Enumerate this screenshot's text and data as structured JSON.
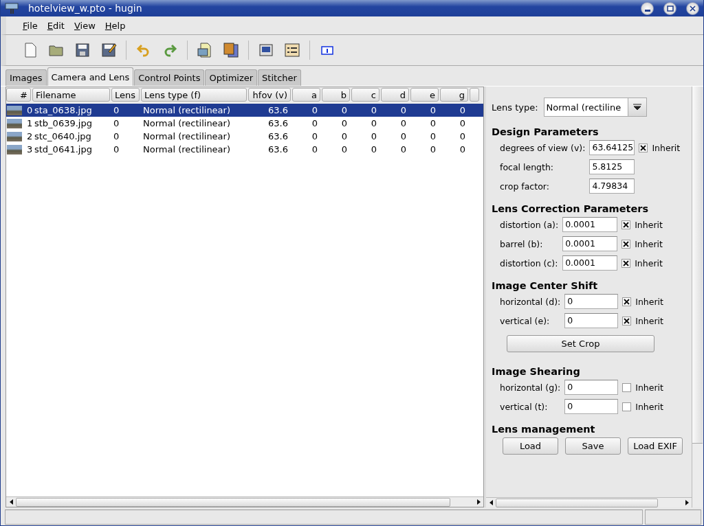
{
  "window": {
    "title": "hotelview_w.pto - hugin"
  },
  "menu": [
    "File",
    "Edit",
    "View",
    "Help"
  ],
  "tabs": [
    {
      "label": "Images",
      "selected": false
    },
    {
      "label": "Camera and Lens",
      "selected": true
    },
    {
      "label": "Control Points",
      "selected": false
    },
    {
      "label": "Optimizer",
      "selected": false
    },
    {
      "label": "Stitcher",
      "selected": false
    }
  ],
  "table": {
    "columns": [
      "#",
      "Filename",
      "Lens",
      "Lens type (f)",
      "hfov (v)",
      "a",
      "b",
      "c",
      "d",
      "e",
      "g"
    ],
    "rows": [
      {
        "cells": [
          "0",
          "sta_0638.jpg",
          "0",
          "Normal (rectilinear)",
          "63.6",
          "0",
          "0",
          "0",
          "0",
          "0",
          "0"
        ],
        "selected": true
      },
      {
        "cells": [
          "1",
          "stb_0639.jpg",
          "0",
          "Normal (rectilinear)",
          "63.6",
          "0",
          "0",
          "0",
          "0",
          "0",
          "0"
        ],
        "selected": false
      },
      {
        "cells": [
          "2",
          "stc_0640.jpg",
          "0",
          "Normal (rectilinear)",
          "63.6",
          "0",
          "0",
          "0",
          "0",
          "0",
          "0"
        ],
        "selected": false
      },
      {
        "cells": [
          "3",
          "std_0641.jpg",
          "0",
          "Normal (rectilinear)",
          "63.6",
          "0",
          "0",
          "0",
          "0",
          "0",
          "0"
        ],
        "selected": false
      }
    ]
  },
  "lens_panel": {
    "lens_type": {
      "label": "Lens type:",
      "value": "Normal (rectiline"
    },
    "sections": [
      {
        "title": "Design Parameters",
        "fields": [
          {
            "kind": "inherit",
            "label": "degrees of view (v):",
            "value": "63.64125",
            "inherit_label": "Inherit",
            "inherit": true
          },
          {
            "kind": "plain",
            "label": "focal length:",
            "value": "5.8125"
          },
          {
            "kind": "plain",
            "label": "crop factor:",
            "value": "4.79834"
          }
        ]
      },
      {
        "title": "Lens Correction Parameters",
        "fields": [
          {
            "kind": "inherit",
            "label": "distortion (a):",
            "value": "0.0001",
            "inherit_label": "Inherit",
            "inherit": true
          },
          {
            "kind": "inherit",
            "label": "barrel (b):",
            "value": "0.0001",
            "inherit_label": "Inherit",
            "inherit": true
          },
          {
            "kind": "inherit",
            "label": "distortion (c):",
            "value": "0.0001",
            "inherit_label": "Inherit",
            "inherit": true
          }
        ]
      },
      {
        "title": "Image Center Shift",
        "fields": [
          {
            "kind": "inherit",
            "label": "horizontal (d):",
            "value": "0",
            "inherit_label": "Inherit",
            "inherit": true
          },
          {
            "kind": "inherit",
            "label": "vertical (e):",
            "value": "0",
            "inherit_label": "Inherit",
            "inherit": true
          }
        ],
        "button": "Set Crop"
      },
      {
        "title": "Image Shearing",
        "fields": [
          {
            "kind": "inherit",
            "label": "horizontal (g):",
            "value": "0",
            "inherit_label": "Inherit",
            "inherit": false
          },
          {
            "kind": "inherit",
            "label": "vertical (t):",
            "value": "0",
            "inherit_label": "Inherit",
            "inherit": false
          }
        ]
      },
      {
        "title": "Lens management",
        "buttons": [
          "Load",
          "Save",
          "Load EXIF"
        ]
      }
    ]
  }
}
